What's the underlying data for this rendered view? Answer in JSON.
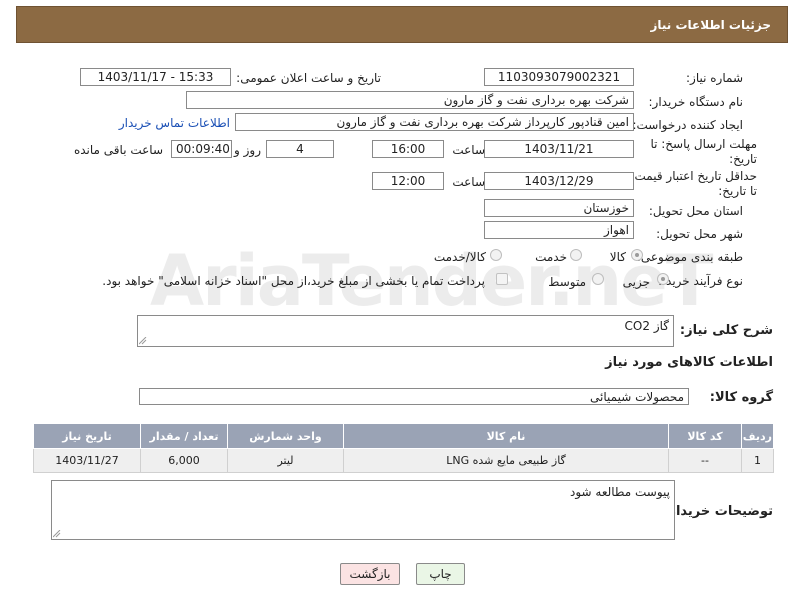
{
  "header": {
    "title": "جزئیات اطلاعات نیاز"
  },
  "fields": {
    "need_number_label": "شماره نیاز:",
    "need_number": "1103093079002321",
    "announce_label": "تاریخ و ساعت اعلان عمومی:",
    "announce_value": "1403/11/17 - 15:33",
    "buyer_org_label": "نام دستگاه خریدار:",
    "buyer_org": "شرکت بهره برداری نفت و گاز مارون",
    "requester_label": "ایجاد کننده درخواست:",
    "requester": "امین قنادپور کارپرداز شرکت بهره برداری نفت و گاز مارون",
    "contact_link": "اطلاعات تماس خریدار",
    "deadline_label": "مهلت ارسال پاسخ: تا تاریخ:",
    "deadline_date": "1403/11/21",
    "time_label": "ساعت",
    "deadline_time": "16:00",
    "days_value": "4",
    "days_label": "روز و",
    "remaining_value": "00:09:40",
    "remaining_label": "ساعت باقی مانده",
    "validity_label": "حداقل تاریخ اعتبار قیمت: تا تاریخ:",
    "validity_date": "1403/12/29",
    "validity_time": "12:00",
    "province_label": "استان محل تحویل:",
    "province": "خوزستان",
    "city_label": "شهر محل تحویل:",
    "city": "اهواز",
    "category_label": "طبقه بندی موضوعی:",
    "category_options": [
      "کالا",
      "خدمت",
      "کالا/خدمت"
    ],
    "process_label": "نوع فرآیند خرید :",
    "process_options": [
      "جزیی",
      "متوسط"
    ],
    "payment_note": "پرداخت تمام یا بخشی از مبلغ خرید،از محل \"اسناد خزانه اسلامی\" خواهد بود.",
    "summary_label": "شرح کلی نیاز:",
    "summary": "گاز CO2",
    "goods_info_title": "اطلاعات کالاهای مورد نیاز",
    "goods_group_label": "گروه کالا:",
    "goods_group": "محصولات شیمیائی",
    "buyer_notes_label": "توضیحات خریدار:",
    "buyer_notes": "پیوست مطالعه شود"
  },
  "table": {
    "headers": [
      "ردیف",
      "کد کالا",
      "نام کالا",
      "واحد شمارش",
      "تعداد / مقدار",
      "تاریخ نیاز"
    ],
    "rows": [
      [
        "1",
        "--",
        "گاز طبیعی مایع شده LNG",
        "لیتر",
        "6,000",
        "1403/11/27"
      ]
    ]
  },
  "buttons": {
    "print": "چاپ",
    "back": "بازگشت"
  },
  "watermark": "AriaTender.neT",
  "colors": {
    "header_bg": "#8c6a43",
    "table_header_bg": "#9aa3b5",
    "link": "#1a4fb5"
  }
}
